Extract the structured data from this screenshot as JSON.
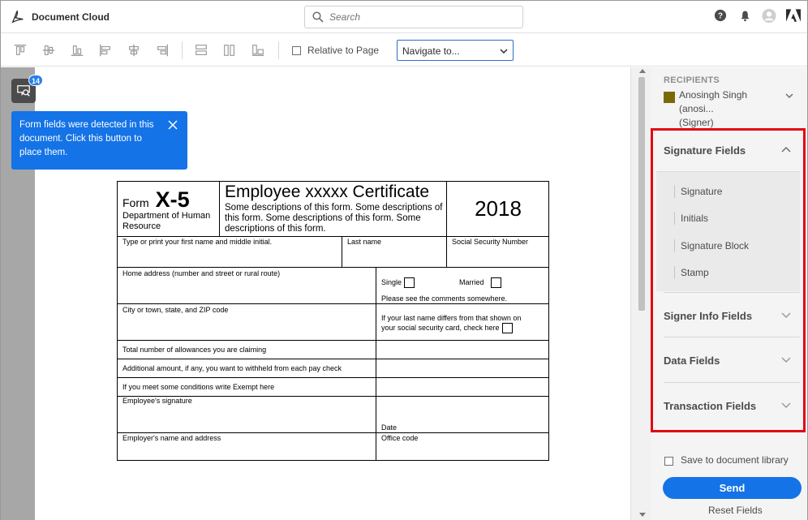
{
  "app": {
    "title": "Document Cloud"
  },
  "search": {
    "placeholder": "Search"
  },
  "toolbar": {
    "relative_label": "Relative to Page",
    "navigate_value": "Navigate to..."
  },
  "fields_button": {
    "badge": "14"
  },
  "tooltip": {
    "text": "Form fields were detected in this document. Click this button to place them."
  },
  "form": {
    "form_word": "Form",
    "form_number": "X-5",
    "dept": "Department of Human Resource",
    "title": "Employee xxxxx Certificate",
    "description": "Some descriptions of this form. Some descriptions of this form. Some descriptions of this form. Some descriptions of this form.",
    "year": "2018",
    "first_name": "Type or print your first name and middle initial.",
    "last_name": "Last name",
    "ssn": "Social Security Number",
    "home_address": "Home address (number and street or rural route)",
    "single": "Single",
    "married": "Married",
    "comments": "Please see the comments somewhere.",
    "city": "City or town, state, and ZIP code",
    "last_name_differs": "If your last name differs from that shown on your social security card, check here",
    "allowances": "Total number of allowances you are claiming",
    "additional": "Additional amount, if any, you want to withheld from each pay check",
    "exempt": "If you meet some conditions write Exempt here",
    "emp_signature": "Employee's signature",
    "date": "Date",
    "employer": "Employer's name and address",
    "office_code": "Office code"
  },
  "right_panel": {
    "recipients_label": "RECIPIENTS",
    "recipient_name": "Anosingh Singh (anosi...",
    "recipient_role": "(Signer)",
    "recipient_color": "#7a6a05",
    "sections": {
      "signature": "Signature Fields",
      "signer_info": "Signer Info Fields",
      "data": "Data Fields",
      "transaction": "Transaction Fields"
    },
    "signature_items": [
      "Signature",
      "Initials",
      "Signature Block",
      "Stamp"
    ],
    "save_library": "Save to document library",
    "send": "Send",
    "reset": "Reset Fields"
  },
  "colors": {
    "accent": "#1473e6",
    "highlight": "#e30613"
  }
}
